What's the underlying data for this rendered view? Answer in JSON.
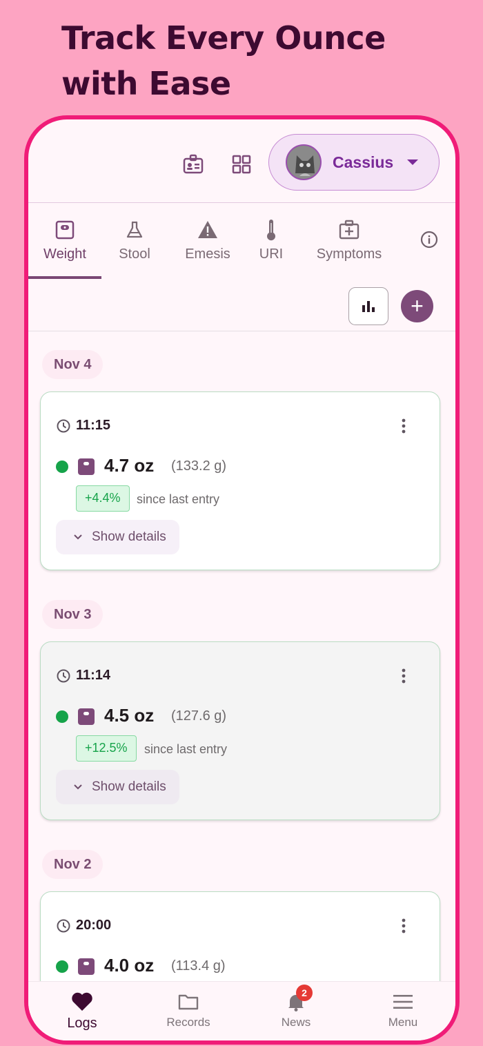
{
  "headline": "Track Every Ounce with Ease",
  "profile": {
    "name": "Cassius"
  },
  "tabs": [
    {
      "label": "Weight",
      "icon": "scale-icon"
    },
    {
      "label": "Stool",
      "icon": "flask-icon"
    },
    {
      "label": "Emesis",
      "icon": "warning-icon"
    },
    {
      "label": "URI",
      "icon": "thermometer-icon"
    },
    {
      "label": "Symptoms",
      "icon": "medical-kit-icon"
    }
  ],
  "active_tab": "Weight",
  "entries": [
    {
      "date": "Nov 4",
      "time": "11:15",
      "weight": "4.7 oz",
      "grams": "(133.2 g)",
      "change": "+4.4%",
      "since": "since last entry",
      "details": "Show details"
    },
    {
      "date": "Nov 3",
      "time": "11:14",
      "weight": "4.5 oz",
      "grams": "(127.6 g)",
      "change": "+12.5%",
      "since": "since last entry",
      "details": "Show details"
    },
    {
      "date": "Nov 2",
      "time": "20:00",
      "weight": "4.0 oz",
      "grams": "(113.4 g)"
    }
  ],
  "bottom_nav": [
    {
      "label": "Logs",
      "icon": "heart-icon"
    },
    {
      "label": "Records",
      "icon": "folder-icon"
    },
    {
      "label": "News",
      "icon": "bell-icon",
      "badge": "2"
    },
    {
      "label": "Menu",
      "icon": "menu-icon"
    }
  ],
  "colors": {
    "background": "#fda4c2",
    "frame": "#f01c78",
    "primary": "#7d4a79",
    "positive": "#16a34a",
    "badge": "#e53935"
  }
}
